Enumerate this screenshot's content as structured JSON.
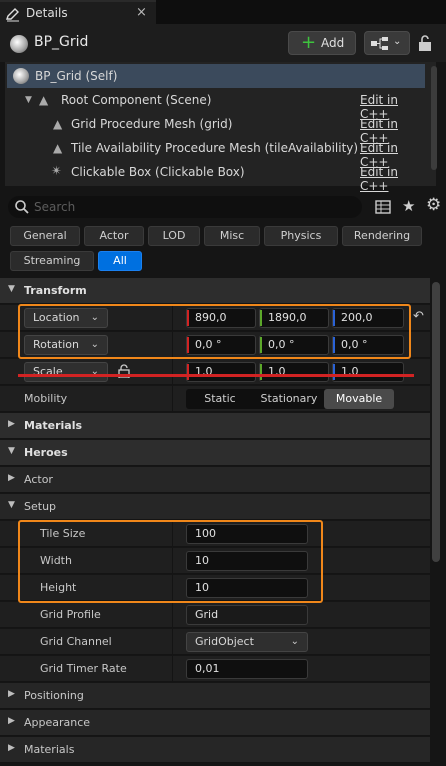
{
  "tab": {
    "title": "Details",
    "close": "×"
  },
  "header": {
    "title": "BP_Grid",
    "add_label": "Add"
  },
  "tree": [
    {
      "label": "BP_Grid (Self)",
      "edit": ""
    },
    {
      "label": "Root Component (Scene)",
      "edit": "Edit in C++"
    },
    {
      "label": "Grid Procedure Mesh (grid)",
      "edit": "Edit in C++"
    },
    {
      "label": "Tile Availability Procedure Mesh (tileAvailability)",
      "edit": "Edit in C++"
    },
    {
      "label": "Clickable Box (Clickable Box)",
      "edit": "Edit in C++"
    }
  ],
  "search": {
    "placeholder": "Search"
  },
  "filters": [
    "General",
    "Actor",
    "LOD",
    "Misc",
    "Physics",
    "Rendering",
    "Streaming",
    "All"
  ],
  "active_filter": "All",
  "transform": {
    "title": "Transform",
    "location": {
      "label": "Location",
      "x": "890,0",
      "y": "1890,0",
      "z": "200,0"
    },
    "rotation": {
      "label": "Rotation",
      "x": "0,0 °",
      "y": "0,0 °",
      "z": "0,0 °"
    },
    "scale": {
      "label": "Scale",
      "x": "1,0",
      "y": "1,0",
      "z": "1,0"
    },
    "mobility": {
      "label": "Mobility",
      "options": [
        "Static",
        "Stationary",
        "Movable"
      ],
      "selected": "Movable"
    }
  },
  "sections": {
    "materials": "Materials",
    "heroes": "Heroes",
    "actor": "Actor",
    "setup": "Setup",
    "positioning": "Positioning",
    "appearance": "Appearance",
    "materials2": "Materials"
  },
  "setup": {
    "tile_size": {
      "label": "Tile Size",
      "value": "100"
    },
    "width": {
      "label": "Width",
      "value": "10"
    },
    "height": {
      "label": "Height",
      "value": "10"
    },
    "grid_profile": {
      "label": "Grid Profile",
      "value": "Grid"
    },
    "grid_channel": {
      "label": "Grid Channel",
      "value": "GridObject"
    },
    "grid_timer_rate": {
      "label": "Grid Timer Rate",
      "value": "0,01"
    }
  },
  "colors": {
    "accent": "#0070e0",
    "highlight": "#f0871a",
    "x_axis": "#d22323",
    "y_axis": "#5ca82a",
    "z_axis": "#2a62d6",
    "add_plus": "#3ec43e"
  }
}
